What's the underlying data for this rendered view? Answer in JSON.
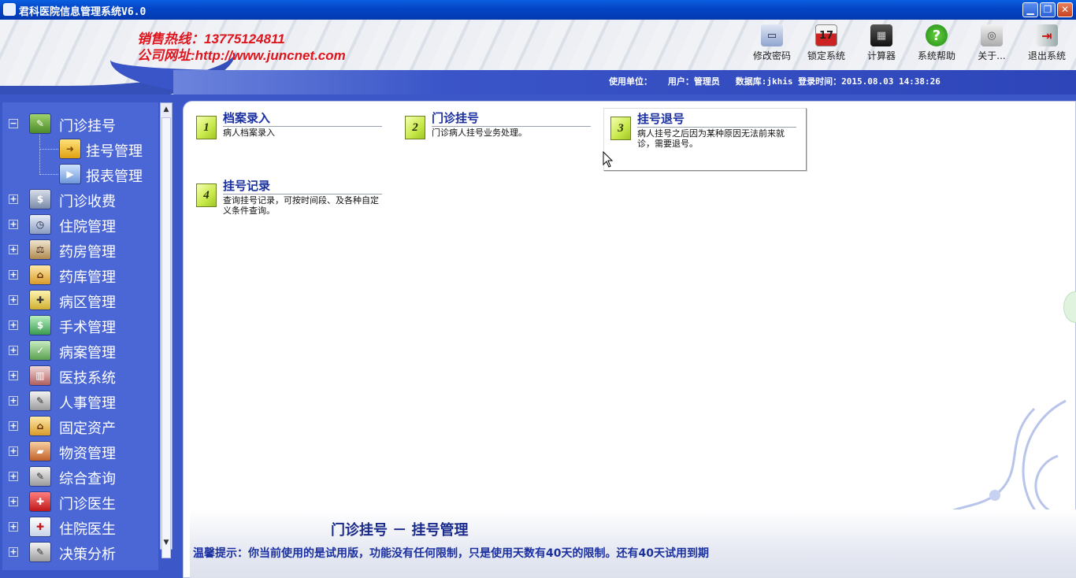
{
  "window": {
    "title": "君科医院信息管理系统V6.0",
    "controls": {
      "minimize": "▁",
      "maximize": "❐",
      "close": "✕"
    }
  },
  "header": {
    "hotline": "销售热线：13775124811",
    "website": "公司网址:http://www.juncnet.com",
    "info": "使用单位：   用户：管理员   数据库:jkhis 登录时间：2015.08.03 14:38:26",
    "tools": [
      {
        "label": "修改密码",
        "icon": "monitor-icon",
        "glyph": "▭"
      },
      {
        "label": "锁定系统",
        "icon": "calendar-icon",
        "glyph": "17"
      },
      {
        "label": "计算器",
        "icon": "calculator-icon",
        "glyph": "▦"
      },
      {
        "label": "系统帮助",
        "icon": "help-icon",
        "glyph": "?"
      },
      {
        "label": "关于...",
        "icon": "about-icon",
        "glyph": "◎"
      },
      {
        "label": "退出系统",
        "icon": "exit-door-icon",
        "glyph": "⇥"
      }
    ]
  },
  "sidebar": {
    "items": [
      {
        "label": "门诊挂号",
        "expander": "−",
        "icon": "registration-icon"
      },
      {
        "label": "门诊收费",
        "expander": "+",
        "icon": "billing-icon"
      },
      {
        "label": "住院管理",
        "expander": "+",
        "icon": "inpatient-icon"
      },
      {
        "label": "药房管理",
        "expander": "+",
        "icon": "pharmacy-icon"
      },
      {
        "label": "药库管理",
        "expander": "+",
        "icon": "warehouse-icon"
      },
      {
        "label": "病区管理",
        "expander": "+",
        "icon": "ward-icon"
      },
      {
        "label": "手术管理",
        "expander": "+",
        "icon": "surgery-icon"
      },
      {
        "label": "病案管理",
        "expander": "+",
        "icon": "case-record-icon"
      },
      {
        "label": "医技系统",
        "expander": "+",
        "icon": "medtech-icon"
      },
      {
        "label": "人事管理",
        "expander": "+",
        "icon": "personnel-icon"
      },
      {
        "label": "固定资产",
        "expander": "+",
        "icon": "assets-icon"
      },
      {
        "label": "物资管理",
        "expander": "+",
        "icon": "supplies-icon"
      },
      {
        "label": "综合查询",
        "expander": "+",
        "icon": "query-icon"
      },
      {
        "label": "门诊医生",
        "expander": "+",
        "icon": "outpatient-doctor-icon"
      },
      {
        "label": "住院医生",
        "expander": "+",
        "icon": "inpatient-doctor-icon"
      },
      {
        "label": "决策分析",
        "expander": "+",
        "icon": "analysis-icon"
      }
    ],
    "subitems": [
      {
        "label": "挂号管理",
        "icon": "arrow-right-icon"
      },
      {
        "label": "报表管理",
        "icon": "report-icon"
      }
    ]
  },
  "cards": [
    {
      "num": "1",
      "title": "档案录入",
      "desc": "病人档案录入"
    },
    {
      "num": "2",
      "title": "门诊挂号",
      "desc": "门诊病人挂号业务处理。"
    },
    {
      "num": "3",
      "title": "挂号退号",
      "desc": "病人挂号之后因为某种原因无法前来就诊，需要退号。"
    },
    {
      "num": "4",
      "title": "挂号记录",
      "desc": "查询挂号记录，可按时间段、及各种自定义条件查询。"
    }
  ],
  "status": {
    "module_title": "门诊挂号 － 挂号管理",
    "notice": "温馨提示：你当前使用的是试用版，功能没有任何限制，只是使用天数有40天的限制。还有40天试用到期"
  },
  "colors": {
    "accent": "#3c57c8",
    "hotline": "#e0141c",
    "card_title": "#1a2fa0"
  }
}
